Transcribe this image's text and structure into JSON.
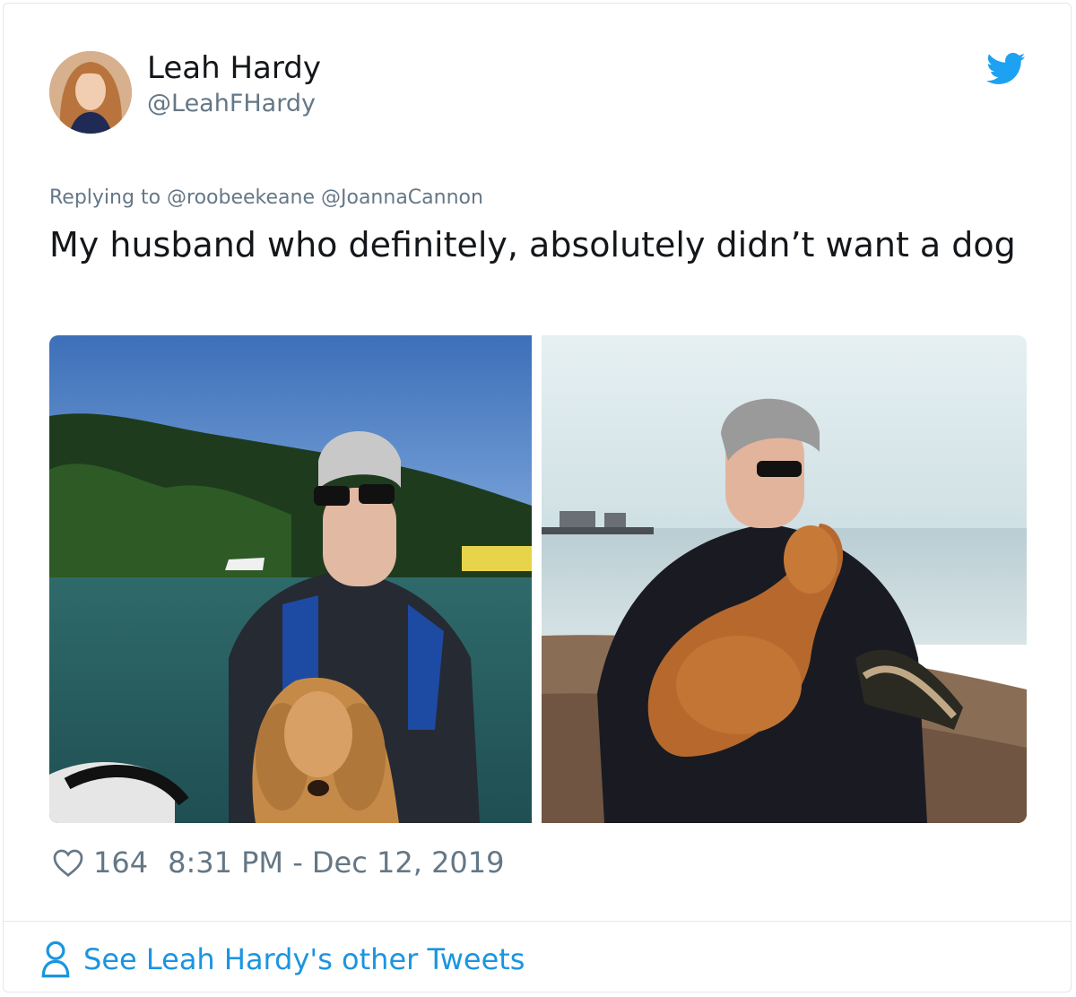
{
  "author": {
    "name": "Leah Hardy",
    "handle": "@LeahFHardy",
    "avatar_icon": "profile-photo"
  },
  "brand": {
    "icon": "twitter-bird-icon",
    "color": "#1da1f2"
  },
  "reply": {
    "prefix": "Replying to",
    "mentions": [
      "@roobeekeane",
      "@JoannaCannon"
    ]
  },
  "tweet": {
    "text": "My husband who definitely, absolutely didn’t want a dog"
  },
  "media": [
    {
      "name": "photo-boat-dog"
    },
    {
      "name": "photo-beach-dog"
    }
  ],
  "footer": {
    "likes": "164",
    "timestamp": "8:31 PM - Dec 12, 2019",
    "heart_icon": "heart-icon"
  },
  "cta": {
    "label": "See Leah Hardy's other Tweets",
    "icon": "person-icon",
    "color": "#1b95e0"
  }
}
